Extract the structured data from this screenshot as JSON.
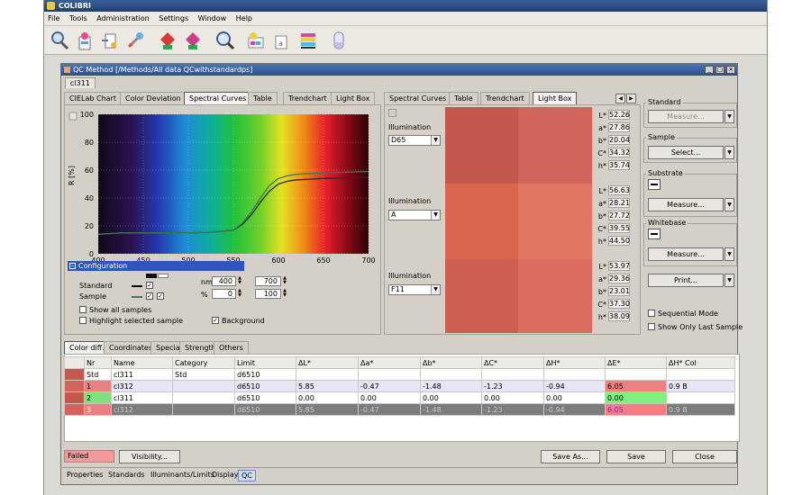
{
  "app": {
    "title": "COLIBRI"
  },
  "menu": [
    "File",
    "Tools",
    "Administration",
    "Settings",
    "Window",
    "Help"
  ],
  "toolbar_icons": [
    "search-icon",
    "wizard-icon",
    "import-icon",
    "tools-icon",
    "measure-standard-icon",
    "measure-sample-icon",
    "inspect-icon",
    "palette-icon",
    "document-icon",
    "color-bars-icon",
    "vial-icon"
  ],
  "window": {
    "title": "QC Method [/Methods/All data QCwithstandardps]",
    "doc_tab": "cl311"
  },
  "left_tabs": [
    "CIELab Chart",
    "Color Deviation",
    "Spectral Curves",
    "Table",
    "Trendchart",
    "Light Box"
  ],
  "left_active_tab": 2,
  "right_tabs": [
    "Spectral Curves",
    "Table",
    "Trendchart",
    "Light Box"
  ],
  "right_active_tab": 3,
  "chart_data": {
    "type": "line",
    "xlabel": "nm",
    "ylabel": "R [%]",
    "xlim": [
      400,
      700
    ],
    "ylim": [
      0,
      100
    ],
    "x_ticks": [
      400,
      450,
      500,
      550,
      600,
      650,
      700
    ],
    "y_ticks": [
      0,
      20,
      40,
      60,
      80,
      100
    ],
    "background": "visible spectrum",
    "series": [
      {
        "x": [
          400,
          425,
          450,
          475,
          500,
          525,
          550,
          560,
          570,
          580,
          590,
          600,
          610,
          620,
          635,
          650,
          675,
          700
        ],
        "y": [
          14,
          15,
          15,
          15,
          15,
          15.5,
          17,
          21,
          28,
          37,
          45,
          50,
          52,
          53,
          53.5,
          54,
          54.5,
          55
        ],
        "color": "#2a2a2a"
      },
      {
        "x": [
          400,
          425,
          450,
          475,
          500,
          525,
          550,
          560,
          570,
          580,
          590,
          600,
          610,
          620,
          635,
          650,
          675,
          700
        ],
        "y": [
          14,
          15,
          15,
          15,
          15,
          15.5,
          17,
          22,
          30,
          40,
          49,
          54,
          56,
          57,
          57.5,
          58,
          58.5,
          59
        ],
        "color": "#3c7a56"
      }
    ]
  },
  "config": {
    "title": "Configuration",
    "standard_label": "Standard",
    "sample_label": "Sample",
    "nm_label": "nm",
    "pct_label": "%",
    "nm_from": "400",
    "nm_to": "700",
    "pct_from": "0",
    "pct_to": "100",
    "show_all_samples": "Show all samples",
    "highlight_selected": "Highlight selected sample",
    "background": "Background"
  },
  "lightbox": [
    {
      "illum_label": "Illumination",
      "illuminant": "D65",
      "std_color": "#c4584c",
      "smp_color": "#d0645a",
      "lab": [
        [
          "L*",
          "52.26"
        ],
        [
          "a*",
          "27.86"
        ],
        [
          "b*",
          "20.04"
        ],
        [
          "C*",
          "34.32"
        ],
        [
          "h*",
          "35.74"
        ]
      ]
    },
    {
      "illum_label": "Illumination",
      "illuminant": "A",
      "std_color": "#d8664f",
      "smp_color": "#e37563",
      "lab": [
        [
          "L*",
          "56.63"
        ],
        [
          "a*",
          "28.21"
        ],
        [
          "b*",
          "27.72"
        ],
        [
          "C*",
          "39.55"
        ],
        [
          "h*",
          "44.50"
        ]
      ]
    },
    {
      "illum_label": "Illumination",
      "illuminant": "F11",
      "std_color": "#cf5d50",
      "smp_color": "#dc6c60",
      "lab": [
        [
          "L*",
          "53.97"
        ],
        [
          "a*",
          "29.36"
        ],
        [
          "b*",
          "23.01"
        ],
        [
          "C*",
          "37.30"
        ],
        [
          "h*",
          "38.09"
        ]
      ]
    }
  ],
  "right_panel": {
    "standard_title": "Standard",
    "standard_btn": "Measure...",
    "sample_title": "Sample",
    "sample_btn": "Select...",
    "substrate_title": "Substrate",
    "substrate_btn": "Measure...",
    "whitebase_title": "Whitebase",
    "whitebase_btn": "Measure...",
    "print_btn": "Print...",
    "sequential": "Sequential Mode",
    "show_last": "Show Only Last Sample"
  },
  "bottom_tabs": [
    "Color diff.",
    "Coordinates",
    "Special",
    "Strength",
    "Others"
  ],
  "table": {
    "headers": [
      "Nr",
      "Name",
      "Category",
      "Limit",
      "ΔL*",
      "Δa*",
      "Δb*",
      "ΔC*",
      "ΔH*",
      "ΔE*",
      "ΔH* Col"
    ],
    "rows": [
      [
        "Std",
        "cl311",
        "Std",
        "d6510",
        "",
        "",
        "",
        "",
        "",
        "",
        ""
      ],
      [
        "1",
        "cl312",
        "",
        "d6510",
        "5.85",
        "-0.47",
        "-1.48",
        "-1.23",
        "-0.94",
        "6.05",
        "0.9 B"
      ],
      [
        "2",
        "cl311",
        "",
        "d6510",
        "0.00",
        "0.00",
        "0.00",
        "0.00",
        "0.00",
        "0.00",
        ""
      ],
      [
        "3",
        "cl312",
        "",
        "d6510",
        "5.85",
        "-0.47",
        "-1.48",
        "-1.23",
        "-0.94",
        "6.05",
        "0.9 B"
      ]
    ]
  },
  "footer": {
    "failed": "Failed",
    "visibility": "Visibility...",
    "save_as": "Save As...",
    "save": "Save",
    "close": "Close"
  },
  "window_tabs": [
    "Properties",
    "Standards",
    "Illuminants/Limits",
    "Display",
    "QC"
  ]
}
